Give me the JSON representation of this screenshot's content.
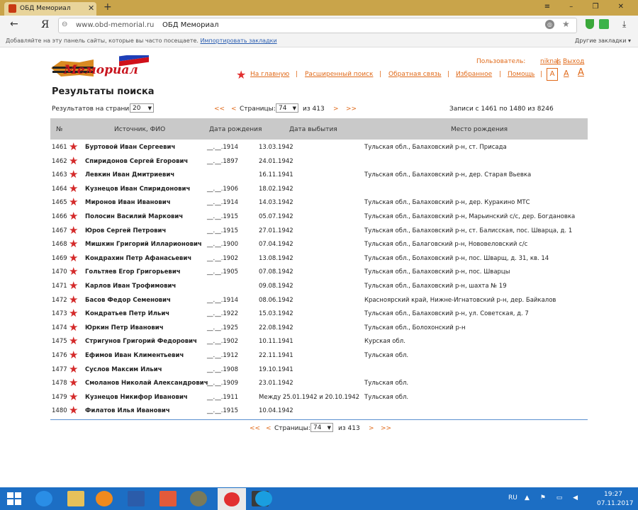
{
  "browser": {
    "tab_title": "ОБД Мемориал",
    "tab_close": "✕",
    "new_tab": "+",
    "window_controls": "≡ – ❐ ✕",
    "back": "←",
    "brand": "Я",
    "url_host": "www.obd-memorial.ru",
    "url_title": "ОБД Мемориал",
    "bookmarks_hint": "Добавляйте на эту панель сайты, которые вы часто посещаете.",
    "bookmarks_import": "Импортировать закладки",
    "other_bookmarks": "Другие закладки ▾"
  },
  "header": {
    "user_label": "Пользователь:",
    "user_name": "niknas",
    "sep": "|",
    "logout": "Выход",
    "nav": [
      "На главную",
      "Расширенный поиск",
      "Обратная связь",
      "Избранное",
      "Помощь"
    ],
    "font_sizes": [
      "A",
      "A",
      "A"
    ]
  },
  "page": {
    "title": "Результаты поиска",
    "per_page_label": "Результатов на страницу:",
    "per_page_value": "20",
    "first": "<<",
    "prev": "<",
    "pages_label": "Страницы:",
    "page_value": "74",
    "of_pages": "из 413",
    "next": ">",
    "last": ">>",
    "records": "Записи с 1461 по 1480 из 8246"
  },
  "table": {
    "headers": [
      "№",
      "Источник, ФИО",
      "Дата рождения",
      "Дата выбытия",
      "Место рождения"
    ],
    "rows": [
      {
        "n": "1461",
        "fio": "Буртовой Иван Сергеевич",
        "birth": "__.__.1914",
        "death": "13.03.1942",
        "place": "Тульская обл., Балаховский р-н, ст. Присада"
      },
      {
        "n": "1462",
        "fio": "Спиридонов Сергей Егорович",
        "birth": "__.__.1897",
        "death": "24.01.1942",
        "place": ""
      },
      {
        "n": "1463",
        "fio": "Левкин Иван Дмитриевич",
        "birth": "",
        "death": "16.11.1941",
        "place": "Тульская обл., Балаховский р-н, дер. Старая Вьевка"
      },
      {
        "n": "1464",
        "fio": "Кузнецов Иван Спиридонович",
        "birth": "__.__.1906",
        "death": "18.02.1942",
        "place": ""
      },
      {
        "n": "1465",
        "fio": "Миронов Иван Иванович",
        "birth": "__.__.1914",
        "death": "14.03.1942",
        "place": "Тульская обл., Балаховский р-н, дер. Куракино МТС"
      },
      {
        "n": "1466",
        "fio": "Полосин Василий Маркович",
        "birth": "__.__.1915",
        "death": "05.07.1942",
        "place": "Тульская обл., Балаховский р-н, Марьинский с/с, дер. Богдановка"
      },
      {
        "n": "1467",
        "fio": "Юров Сергей Петрович",
        "birth": "__.__.1915",
        "death": "27.01.1942",
        "place": "Тульская обл., Балаховский р-н, ст. Балисская, пос. Шварца, д. 1"
      },
      {
        "n": "1468",
        "fio": "Мишкин Григорий Илларионович",
        "birth": "__.__.1900",
        "death": "07.04.1942",
        "place": "Тульская обл., Балаговский р-н, Нововеловский с/с"
      },
      {
        "n": "1469",
        "fio": "Кондрахин Петр Афанасьевич",
        "birth": "__.__.1902",
        "death": "13.08.1942",
        "place": "Тульская обл., Болаховский р-н, пос. Шварщ, д. 31, кв. 14"
      },
      {
        "n": "1470",
        "fio": "Гольтяев Егор Григорьевич",
        "birth": "__.__.1905",
        "death": "07.08.1942",
        "place": "Тульская обл., Балаховский р-н, пос. Шварцы"
      },
      {
        "n": "1471",
        "fio": "Карлов Иван Трофимович",
        "birth": "",
        "death": "09.08.1942",
        "place": "Тульская обл., Балаховский р-н, шахта № 19"
      },
      {
        "n": "1472",
        "fio": "Басов Федор Семенович",
        "birth": "__.__.1914",
        "death": "08.06.1942",
        "place": "Красноярский край, Нижне-Игнатовский р-н, дер. Байкалов"
      },
      {
        "n": "1473",
        "fio": "Кондратьев Петр Ильич",
        "birth": "__.__.1922",
        "death": "15.03.1942",
        "place": "Тульская обл., Балаховский р-н, ул. Советская, д. 7"
      },
      {
        "n": "1474",
        "fio": "Юркин Петр Иванович",
        "birth": "__.__.1925",
        "death": "22.08.1942",
        "place": "Тульская обл., Болохонский р-н"
      },
      {
        "n": "1475",
        "fio": "Стригунов Григорий Федорович",
        "birth": "__.__.1902",
        "death": "10.11.1941",
        "place": "Курская обл."
      },
      {
        "n": "1476",
        "fio": "Ефимов Иван Климентьевич",
        "birth": "__.__.1912",
        "death": "22.11.1941",
        "place": "Тульская обл."
      },
      {
        "n": "1477",
        "fio": "Суслов Максим Ильич",
        "birth": "__.__.1908",
        "death": "19.10.1941",
        "place": ""
      },
      {
        "n": "1478",
        "fio": "Смоланов Николай Александрович",
        "birth": "__.__.1909",
        "death": "23.01.1942",
        "place": "Тульская обл."
      },
      {
        "n": "1479",
        "fio": "Кузнецов Никифор Иванович",
        "birth": "__.__.1911",
        "death": "Между 25.01.1942 и 20.10.1942",
        "place": "Тульская обл."
      },
      {
        "n": "1480",
        "fio": "Филатов Илья Иванович",
        "birth": "__.__.1915",
        "death": "10.04.1942",
        "place": ""
      }
    ]
  },
  "taskbar": {
    "lang": "RU",
    "time": "19:27",
    "date": "07.11.2017"
  }
}
